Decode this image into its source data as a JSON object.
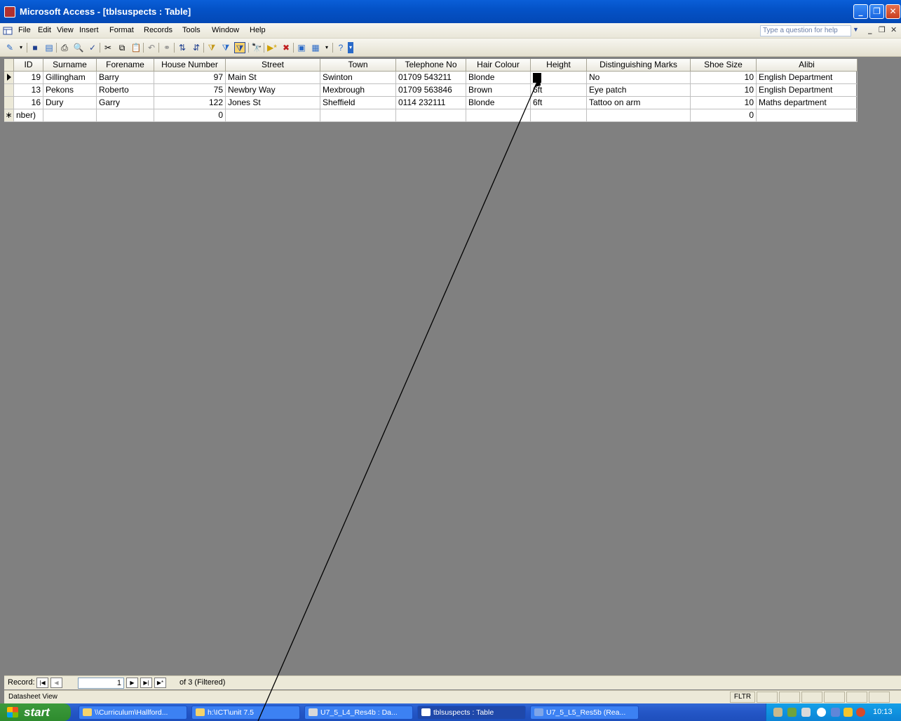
{
  "window": {
    "title": "Microsoft Access - [tblsuspects : Table]"
  },
  "menubar": {
    "items": [
      "File",
      "Edit",
      "View",
      "Insert",
      "Format",
      "Records",
      "Tools",
      "Window",
      "Help"
    ],
    "help_placeholder": "Type a question for help"
  },
  "table": {
    "columns": [
      "ID",
      "Surname",
      "Forename",
      "House Number",
      "Street",
      "Town",
      "Telephone No",
      "Hair Colour",
      "Height",
      "Distinguishing Marks",
      "Shoe Size",
      "Alibi"
    ],
    "rows": [
      [
        "19",
        "Gillingham",
        "Barry",
        "97",
        "Main St",
        "Swinton",
        "01709 543211",
        "Blonde",
        "",
        "No",
        "10",
        "English Department"
      ],
      [
        "13",
        "Pekons",
        "Roberto",
        "75",
        "Newbry Way",
        "Mexbrough",
        "01709 563846",
        "Brown",
        "6ft",
        "Eye patch",
        "10",
        "English Department"
      ],
      [
        "16",
        "Dury",
        "Garry",
        "122",
        "Jones St",
        "Sheffield",
        "0114  232111",
        "Blonde",
        "6ft",
        "Tattoo on arm",
        "10",
        "Maths department"
      ]
    ],
    "new_row": {
      "id": "nber)",
      "house_number": "0",
      "shoe_size": "0"
    }
  },
  "record_nav": {
    "label": "Record:",
    "current": "1",
    "of_text": "of 3 (Filtered)"
  },
  "status": {
    "view": "Datasheet View",
    "filter": "FLTR"
  },
  "taskbar": {
    "start": "start",
    "tasks": [
      "\\\\Curriculum\\Hallford...",
      "h:\\ICT\\unit 7.5",
      "U7_5_L4_Res4b : Da...",
      "tblsuspects : Table",
      "U7_5_L5_Res5b (Rea..."
    ],
    "clock": "10:13"
  },
  "colors": {
    "titlebar": "#0452c7",
    "workspace": "#808080",
    "taskbar": "#2456c6",
    "start": "#2e8b2e"
  }
}
